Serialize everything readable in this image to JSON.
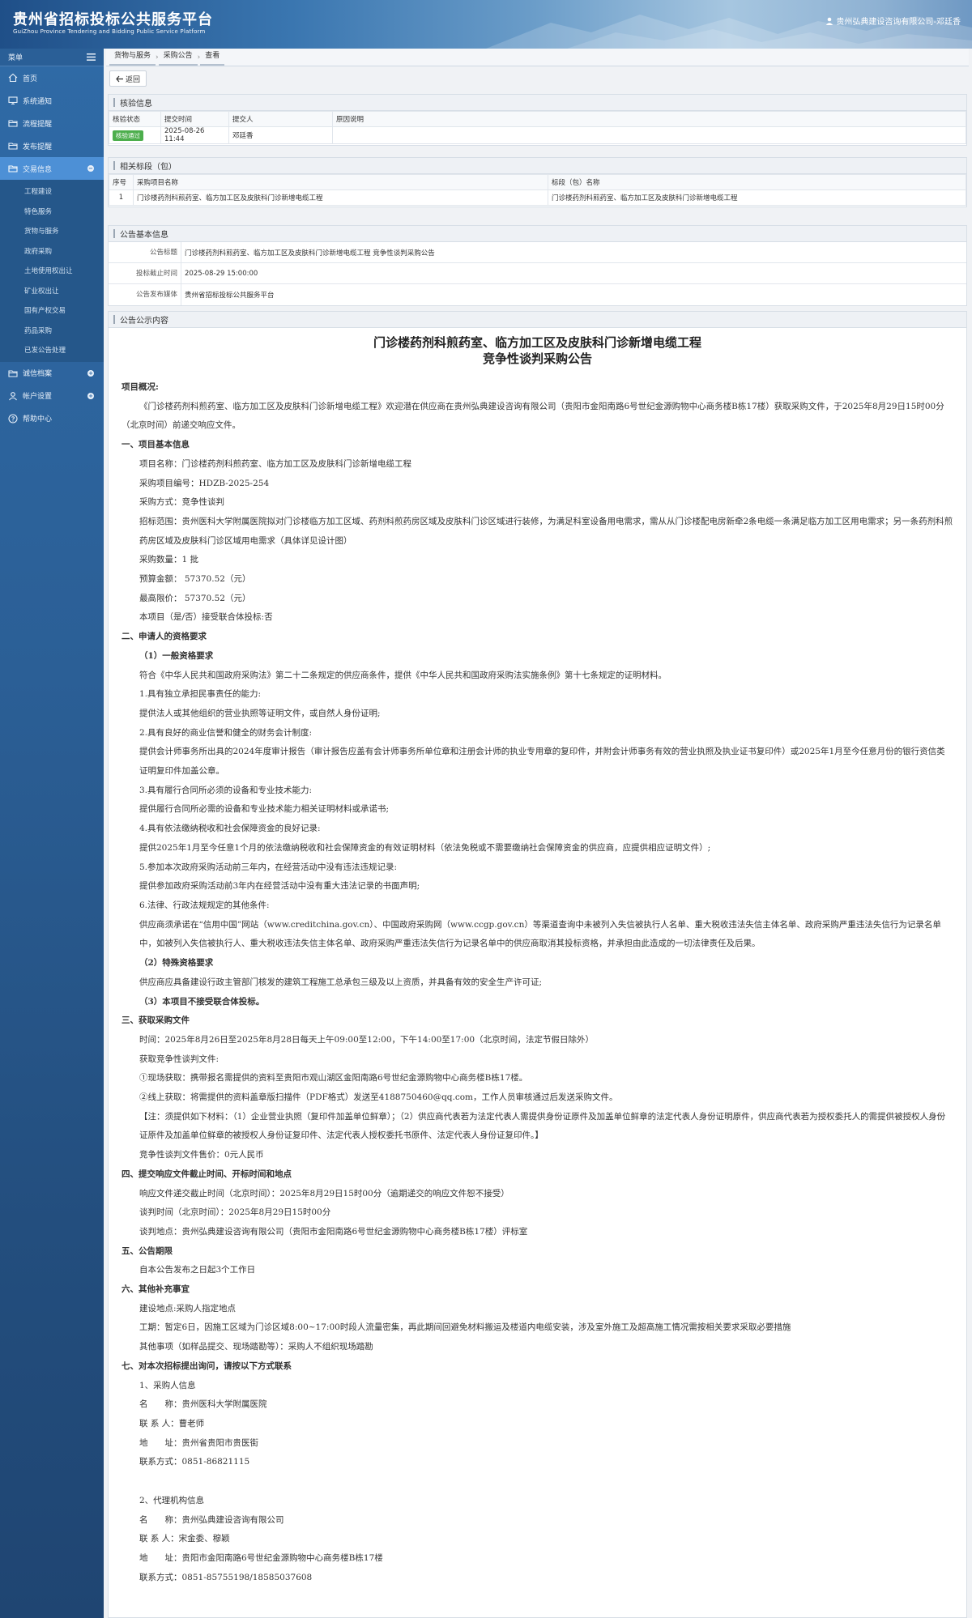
{
  "header": {
    "title_cn": "贵州省招标投标公共服务平台",
    "title_en": "GuiZhou Province Tendering and Bidding Public Service Platform",
    "user": "贵州弘典建设咨询有限公司-邓廷香"
  },
  "sidebar": {
    "menu_label": "菜单",
    "items": [
      {
        "label": "首页",
        "icon": "home-icon"
      },
      {
        "label": "系统通知",
        "icon": "monitor-icon"
      },
      {
        "label": "流程提醒",
        "icon": "folder-icon"
      },
      {
        "label": "发布提醒",
        "icon": "folder-icon"
      },
      {
        "label": "交易信息",
        "icon": "folder-icon"
      }
    ],
    "sub_items": [
      "工程建设",
      "特色服务",
      "货物与服务",
      "政府采购",
      "土地使用权出让",
      "矿业权出让",
      "国有产权交易",
      "药品采购",
      "已发公告处理"
    ],
    "bottom_items": [
      {
        "label": "诚信档案",
        "icon": "folder-icon"
      },
      {
        "label": "帐户设置",
        "icon": "user-icon"
      },
      {
        "label": "帮助中心",
        "icon": "help-icon"
      }
    ]
  },
  "breadcrumb": [
    "货物与服务",
    "采购公告",
    "查看"
  ],
  "back_label": "返回",
  "review": {
    "title": "核验信息",
    "headers": [
      "核验状态",
      "提交时间",
      "提交人",
      "原因说明"
    ],
    "status": "核验通过",
    "time": "2025-08-26 11:44",
    "submitter": "邓廷香",
    "reason": ""
  },
  "lots": {
    "title": "相关标段（包）",
    "headers": [
      "序号",
      "采购项目名称",
      "标段（包）名称"
    ],
    "rows": [
      {
        "no": "1",
        "project": "门诊楼药剂科煎药室、临方加工区及皮肤科门诊新增电缆工程",
        "lot": "门诊楼药剂科煎药室、临方加工区及皮肤科门诊新增电缆工程"
      }
    ]
  },
  "basic": {
    "title": "公告基本信息",
    "rows": [
      {
        "label": "公告标题",
        "value": "门诊楼药剂科煎药室、临方加工区及皮肤科门诊新增电缆工程 竞争性谈判采购公告"
      },
      {
        "label": "投标截止时间",
        "value": "2025-08-29 15:00:00"
      },
      {
        "label": "公告发布媒体",
        "value": "贵州省招标投标公共服务平台"
      }
    ]
  },
  "content": {
    "title": "公告公示内容",
    "doc_title_1": "门诊楼药剂科煎药室、临方加工区及皮肤科门诊新增电缆工程",
    "doc_title_2": "竞争性谈判采购公告",
    "lines": [
      {
        "t": "项目概况:",
        "c": "h"
      },
      {
        "t": "《门诊楼药剂科煎药室、临方加工区及皮肤科门诊新增电缆工程》欢迎潜在供应商在贵州弘典建设咨询有限公司（贵阳市金阳南路6号世纪金源购物中心商务楼B栋17楼）获取采购文件，于2025年8月29日15时00分（北京时间）前递交响应文件。",
        "c": "ind2"
      },
      {
        "t": "一、项目基本信息",
        "c": "h"
      },
      {
        "t": "项目名称：门诊楼药剂科煎药室、临方加工区及皮肤科门诊新增电缆工程",
        "c": "ind"
      },
      {
        "t": "采购项目编号：HDZB-2025-254",
        "c": "ind"
      },
      {
        "t": "采购方式：竞争性谈判",
        "c": "ind"
      },
      {
        "t": "招标范围：贵州医科大学附属医院拟对门诊楼临方加工区域、药剂科煎药房区域及皮肤科门诊区域进行装修，为满足科室设备用电需求，需从从门诊楼配电房新牵2条电缆一条满足临方加工区用电需求；另一条药剂科煎药房区域及皮肤科门诊区域用电需求（具体详见设计图）",
        "c": "ind"
      },
      {
        "t": "采购数量：1 批",
        "c": "ind"
      },
      {
        "t": "预算金额： 57370.52（元）",
        "c": "ind"
      },
      {
        "t": "最高限价： 57370.52（元）",
        "c": "ind"
      },
      {
        "t": "本项目（是/否）接受联合体投标:否",
        "c": "ind"
      },
      {
        "t": "二、申请人的资格要求",
        "c": "h"
      },
      {
        "t": "（1）一般资格要求",
        "c": "ind h"
      },
      {
        "t": "符合《中华人民共和国政府采购法》第二十二条规定的供应商条件，提供《中华人民共和国政府采购法实施条例》第十七条规定的证明材料。",
        "c": "ind"
      },
      {
        "t": "1.具有独立承担民事责任的能力:",
        "c": "ind"
      },
      {
        "t": "提供法人或其他组织的营业执照等证明文件，或自然人身份证明;",
        "c": "ind"
      },
      {
        "t": "2.具有良好的商业信誉和健全的财务会计制度:",
        "c": "ind"
      },
      {
        "t": "提供会计师事务所出具的2024年度审计报告（审计报告应盖有会计师事务所单位章和注册会计师的执业专用章的复印件，并附会计师事务有效的营业执照及执业证书复印件）或2025年1月至今任意月份的银行资信类证明复印件加盖公章。",
        "c": "ind"
      },
      {
        "t": "3.具有履行合同所必须的设备和专业技术能力:",
        "c": "ind"
      },
      {
        "t": "提供履行合同所必需的设备和专业技术能力相关证明材料或承诺书;",
        "c": "ind"
      },
      {
        "t": "4.具有依法缴纳税收和社会保障资金的良好记录:",
        "c": "ind"
      },
      {
        "t": "提供2025年1月至今任意1个月的依法缴纳税收和社会保障资金的有效证明材料（依法免税或不需要缴纳社会保障资金的供应商，应提供相应证明文件）;",
        "c": "ind"
      },
      {
        "t": "5.参加本次政府采购活动前三年内，在经营活动中没有违法违规记录:",
        "c": "ind"
      },
      {
        "t": "提供参加政府采购活动前3年内在经营活动中没有重大违法记录的书面声明;",
        "c": "ind"
      },
      {
        "t": "6.法律、行政法规规定的其他条件:",
        "c": "ind"
      },
      {
        "t": "供应商须承诺在“信用中国”网站（www.creditchina.gov.cn）、中国政府采购网（www.ccgp.gov.cn）等渠道查询中未被列入失信被执行人名单、重大税收违法失信主体名单、政府采购严重违法失信行为记录名单中，如被列入失信被执行人、重大税收违法失信主体名单、政府采购严重违法失信行为记录名单中的供应商取消其投标资格，并承担由此造成的一切法律责任及后果。",
        "c": "ind"
      },
      {
        "t": "（2）特殊资格要求",
        "c": "ind h"
      },
      {
        "t": "供应商应具备建设行政主管部门核发的建筑工程施工总承包三级及以上资质，并具备有效的安全生产许可证;",
        "c": "ind"
      },
      {
        "t": "（3）本项目不接受联合体投标。",
        "c": "ind h"
      },
      {
        "t": "三、获取采购文件",
        "c": "h"
      },
      {
        "t": "时间：2025年8月26日至2025年8月28日每天上午09:00至12:00，下午14:00至17:00（北京时间，法定节假日除外）",
        "c": "ind"
      },
      {
        "t": "获取竞争性谈判文件:",
        "c": "ind"
      },
      {
        "t": "①现场获取：携带报名需提供的资料至贵阳市观山湖区金阳南路6号世纪金源购物中心商务楼B栋17楼。",
        "c": "ind"
      },
      {
        "t": "②线上获取：将需提供的资料盖章版扫描件（PDF格式）发送至4188750460@qq.com，工作人员审核通过后发送采购文件。",
        "c": "ind"
      },
      {
        "t": "【注：须提供如下材料：（1）企业营业执照（复印件加盖单位鲜章）；（2）供应商代表若为法定代表人需提供身份证原件及加盖单位鲜章的法定代表人身份证明原件，供应商代表若为授权委托人的需提供被授权人身份证原件及加盖单位鲜章的被授权人身份证复印件、法定代表人授权委托书原件、法定代表人身份证复印件。】",
        "c": "ind"
      },
      {
        "t": "竞争性谈判文件售价：0元人民币",
        "c": "ind"
      },
      {
        "t": "四、提交响应文件截止时间、开标时间和地点",
        "c": "h"
      },
      {
        "t": "响应文件递交截止时间（北京时间）：2025年8月29日15时00分（逾期递交的响应文件恕不接受）",
        "c": "ind"
      },
      {
        "t": "谈判时间（北京时间）：2025年8月29日15时00分",
        "c": "ind"
      },
      {
        "t": "谈判地点：贵州弘典建设咨询有限公司（贵阳市金阳南路6号世纪金源购物中心商务楼B栋17楼）评标室",
        "c": "ind"
      },
      {
        "t": "五、公告期限",
        "c": "h"
      },
      {
        "t": "自本公告发布之日起3个工作日",
        "c": "ind"
      },
      {
        "t": "六、其他补充事宜",
        "c": "h"
      },
      {
        "t": "建设地点:采购人指定地点",
        "c": "ind"
      },
      {
        "t": "工期：暂定6日，因施工区域为门诊区域8:00~17:00时段人流量密集，再此期间回避免材料搬运及楼道内电缆安装，涉及室外施工及超高施工情况需按相关要求采取必要措施",
        "c": "ind"
      },
      {
        "t": "其他事项（如样品提交、现场踏勘等）：采购人不组织现场踏勘",
        "c": "ind"
      },
      {
        "t": "七、对本次招标提出询问，请按以下方式联系",
        "c": "h"
      },
      {
        "t": "1、采购人信息",
        "c": "ind"
      },
      {
        "t": "名　　称：贵州医科大学附属医院",
        "c": "ind"
      },
      {
        "t": "联 系 人：曹老师",
        "c": "ind"
      },
      {
        "t": "地　　址：贵州省贵阳市贵医街",
        "c": "ind"
      },
      {
        "t": "联系方式：0851-86821115",
        "c": "ind"
      },
      {
        "t": "",
        "c": "gap"
      },
      {
        "t": "2、代理机构信息",
        "c": "ind"
      },
      {
        "t": "名　　称：贵州弘典建设咨询有限公司",
        "c": "ind"
      },
      {
        "t": "联 系 人：宋金委、穆颖",
        "c": "ind"
      },
      {
        "t": "地　　址：贵阳市金阳南路6号世纪金源购物中心商务楼B栋17楼",
        "c": "ind"
      },
      {
        "t": "联系方式：0851-85755198/18585037608",
        "c": "ind"
      }
    ]
  }
}
